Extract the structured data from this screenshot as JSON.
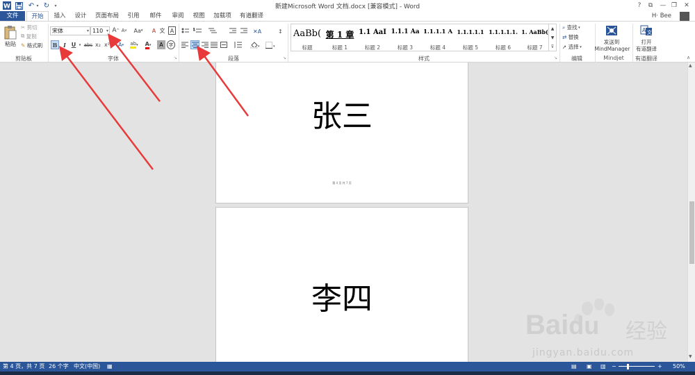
{
  "window": {
    "title": "新建Microsoft Word 文档.docx [兼容模式] - Word",
    "user": "H· Bee",
    "buttons": {
      "help": "?",
      "ribbon_opts": "⧉",
      "minimize": "—",
      "restore": "❐",
      "close": "✕"
    }
  },
  "qat": {
    "save": "💾",
    "undo": "↶",
    "redo": "↻",
    "customize": "▾"
  },
  "tabs": [
    "文件",
    "开始",
    "插入",
    "设计",
    "页面布局",
    "引用",
    "邮件",
    "审阅",
    "视图",
    "加载项",
    "有道翻译"
  ],
  "clipboard": {
    "paste": "粘贴",
    "cut": "剪切",
    "copy": "复制",
    "format_painter": "格式刷",
    "label": "剪贴板"
  },
  "font": {
    "name": "宋体",
    "size": "110",
    "label": "字体",
    "bold": "B",
    "italic": "I",
    "underline": "U",
    "strike": "abc",
    "subscript": "x₂",
    "superscript": "x²",
    "grow": "A",
    "shrink": "A",
    "case": "Aa",
    "clear": "A",
    "phonetic": "文",
    "border": "A",
    "highlight": "ab",
    "color": "A",
    "shade": "A",
    "enclose": "字"
  },
  "paragraph": {
    "label": "段落"
  },
  "styles": {
    "label": "样式",
    "items": [
      {
        "sample": "AaBb(",
        "name": "标题"
      },
      {
        "sample": "第 1 章",
        "name": "标题 1"
      },
      {
        "sample": "1.1",
        "name": "标题 2"
      },
      {
        "sample": "1.1.1",
        "name": "标题 3"
      },
      {
        "sample": "1.1.1.1",
        "name": "标题 4"
      },
      {
        "sample": "1.1.1.1.1",
        "name": "标题 5"
      },
      {
        "sample": "1.1.1.1.1.",
        "name": "标题 6"
      },
      {
        "sample": "1.",
        "name": "标题 7"
      }
    ],
    "extra_samples": [
      "AaI",
      "Aa",
      "A",
      "AaBb("
    ]
  },
  "editing": {
    "find": "查找",
    "replace": "替换",
    "select": "选择",
    "label": "编辑"
  },
  "mindjet": {
    "send": "发送到",
    "send2": "MindManager",
    "label": "Mindjet"
  },
  "youdao": {
    "open": "打开",
    "open2": "有道翻译",
    "label": "有道翻译"
  },
  "document": {
    "page1_text": "张三",
    "page1_footer": "第 4 页 共 7 页",
    "page2_text": "李四"
  },
  "status": {
    "page": "第 4 页，共 7 页",
    "words": "26 个字",
    "lang": "中文(中国)",
    "zoom": "50%"
  },
  "watermark": {
    "brand": "Bai",
    "brand2": "du",
    "cn": "经验",
    "url": "jingyan.baidu.com"
  },
  "colors": {
    "accent": "#2b579a",
    "arrow": "#e83a3a",
    "highlight": "#c5dcf4"
  }
}
